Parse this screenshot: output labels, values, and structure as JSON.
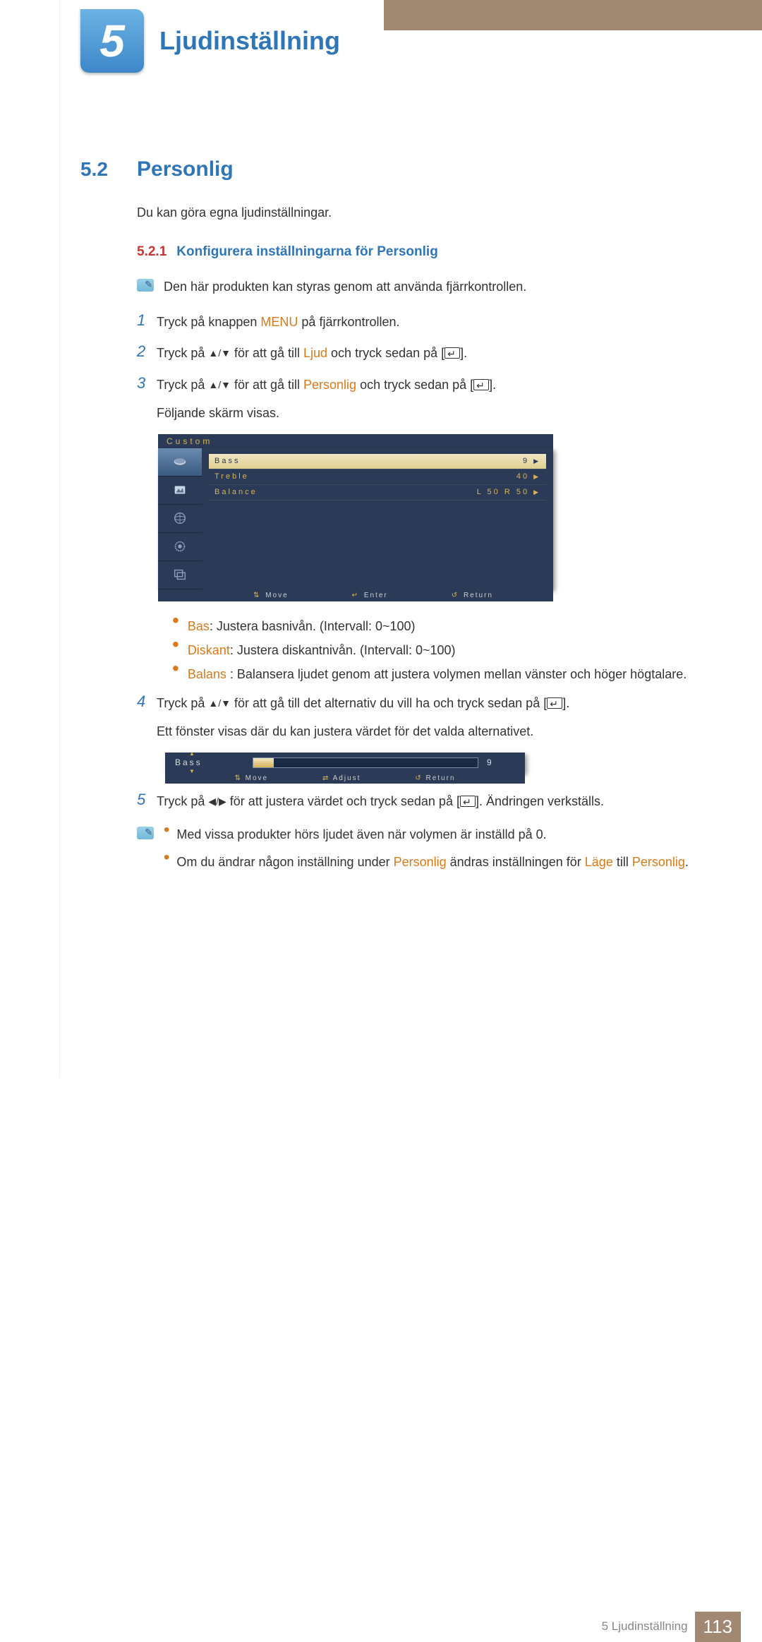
{
  "chapter": {
    "num": "5",
    "title": "Ljudinställning"
  },
  "section": {
    "num": "5.2",
    "title": "Personlig"
  },
  "intro": "Du kan göra egna ljudinställningar.",
  "subsection": {
    "num": "5.2.1",
    "title": "Konfigurera inställningarna för Personlig"
  },
  "note1": "Den här produkten kan styras genom att använda fjärrkontrollen.",
  "steps": {
    "s1": {
      "pre": "Tryck på knappen ",
      "menu": "MENU",
      "post": " på fjärrkontrollen."
    },
    "s2": {
      "pre": "Tryck på ",
      "mid": " för att gå till ",
      "target": "Ljud",
      "post": " och tryck sedan på [",
      "end": "]."
    },
    "s3": {
      "pre": "Tryck på ",
      "mid": " för att gå till ",
      "target": "Personlig",
      "post": " och tryck sedan på [",
      "end": "].",
      "line2": "Följande skärm visas."
    },
    "s4": {
      "pre": "Tryck på ",
      "mid": " för att gå till det alternativ du vill ha och tryck sedan på [",
      "end": "].",
      "line2": "Ett fönster visas där du kan justera värdet för det valda alternativet."
    },
    "s5": {
      "pre": "Tryck på ",
      "mid": " för att justera värdet och tryck sedan på [",
      "end": "]. Ändringen verkställs."
    }
  },
  "osd": {
    "title": "Custom",
    "rows": [
      {
        "label": "Bass",
        "value": "9"
      },
      {
        "label": "Treble",
        "value": "40"
      },
      {
        "label": "Balance",
        "value": "L 50  R 50"
      }
    ],
    "footer": {
      "move": "Move",
      "enter": "Enter",
      "return": "Return"
    }
  },
  "bullets1": {
    "b1": {
      "term": "Bas",
      "text": ": Justera basnivån. (Intervall: 0~100)"
    },
    "b2": {
      "term": "Diskant",
      "text": ": Justera diskantnivån. (Intervall: 0~100)"
    },
    "b3": {
      "term": "Balans",
      "text": " : Balansera ljudet genom att justera volymen mellan vänster och höger högtalare."
    }
  },
  "osd2": {
    "label": "Bass",
    "value": "9",
    "footer": {
      "move": "Move",
      "adjust": "Adjust",
      "return": "Return"
    }
  },
  "note2": {
    "b1": "Med vissa produkter hörs ljudet även när volymen är inställd på 0.",
    "b2": {
      "p1": "Om du ändrar någon inställning under ",
      "t1": "Personlig",
      "p2": " ändras inställningen för ",
      "t2": "Läge",
      "p3": " till ",
      "t3": "Personlig",
      "p4": "."
    }
  },
  "footer": {
    "label": "5 Ljudinställning",
    "page": "113"
  }
}
